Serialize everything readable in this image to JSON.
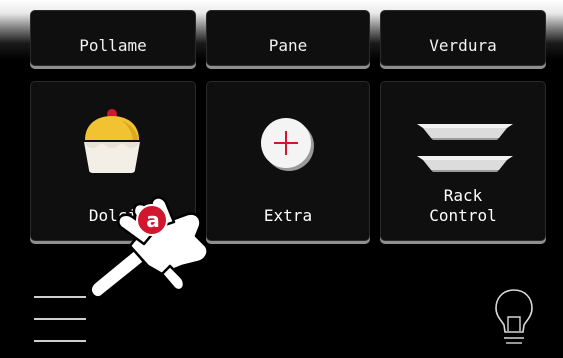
{
  "tiles_top": {
    "pollame": "Pollame",
    "pane": "Pane",
    "verdura": "Verdura"
  },
  "tiles_main": {
    "dolci": "Dolci",
    "extra": "Extra",
    "rack": "Rack\nControl"
  },
  "hint_badge": "a",
  "colors": {
    "background": "#000000",
    "tile": "#0f0f10",
    "accent_red": "#d1162e",
    "cupcake_yellow": "#f1c232"
  }
}
